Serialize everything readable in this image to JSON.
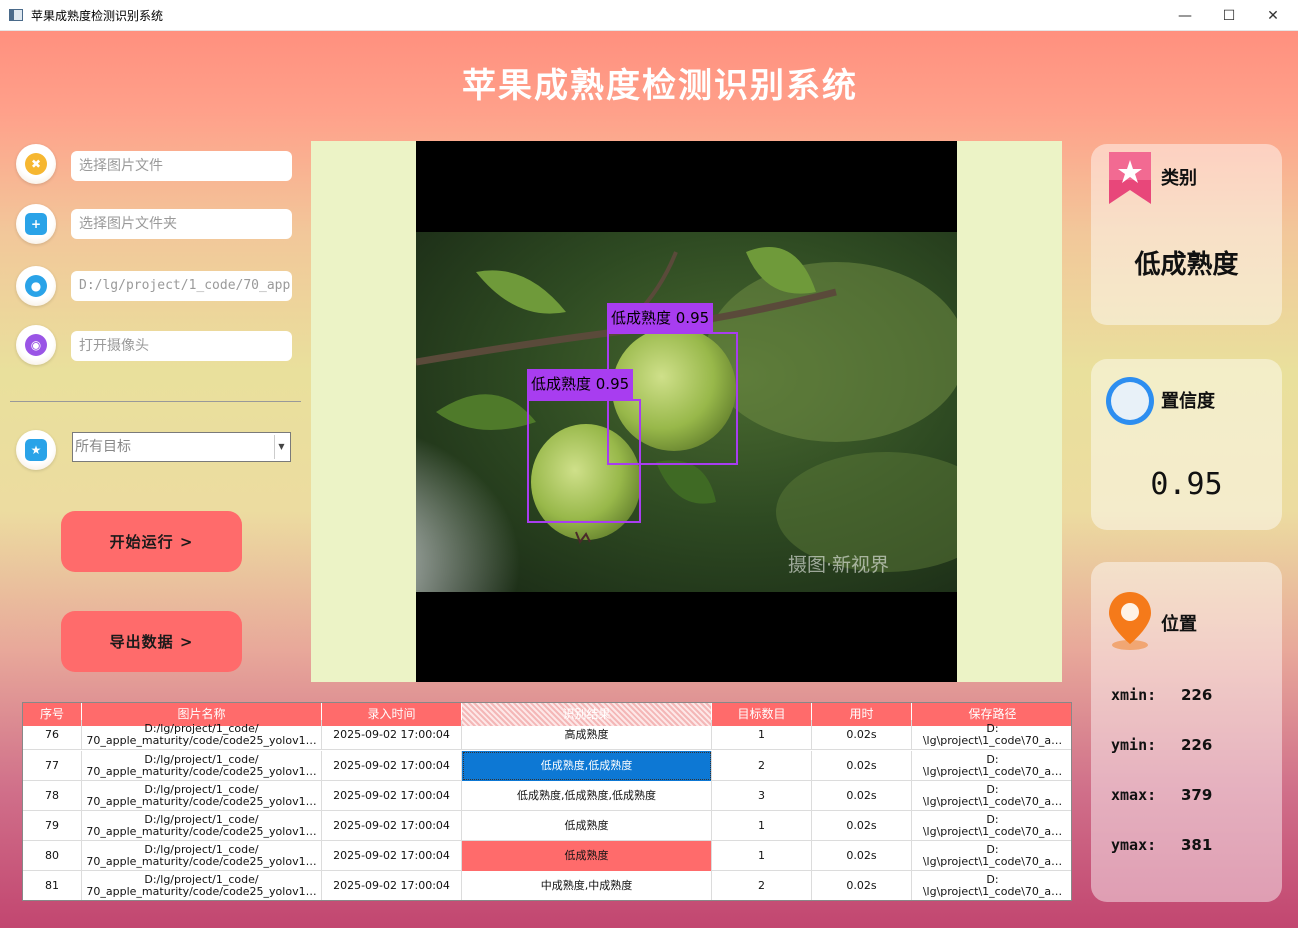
{
  "window": {
    "title": "苹果成熟度检测识别系统"
  },
  "header": {
    "title": "苹果成熟度检测识别系统"
  },
  "left_panel": {
    "image_file_placeholder": "选择图片文件",
    "image_folder_placeholder": "选择图片文件夹",
    "video_path_value": "D:/lg/project/1_code/70_app",
    "camera_placeholder": "打开摄像头",
    "target_select_value": "所有目标",
    "run_button": "开始运行 >",
    "export_button": "导出数据 >"
  },
  "viewer": {
    "watermark": "摄图·新视界",
    "detections": [
      {
        "label": "低成熟度 0.95"
      },
      {
        "label": "低成熟度 0.95"
      }
    ]
  },
  "result_cards": {
    "class_title": "类别",
    "class_value": "低成熟度",
    "confidence_title": "置信度",
    "confidence_value": "0.95",
    "position_title": "位置",
    "xmin_label": "xmin:",
    "xmin_value": "226",
    "ymin_label": "ymin:",
    "ymin_value": "226",
    "xmax_label": "xmax:",
    "xmax_value": "379",
    "ymax_label": "ymax:",
    "ymax_value": "381"
  },
  "table": {
    "headers": [
      "序号",
      "图片名称",
      "录入时间",
      "识别结果",
      "目标数目",
      "用时",
      "保存路径"
    ],
    "rows": [
      {
        "idx": "76",
        "name1": "D:/lg/project/1_code/",
        "name2": "70_apple_maturity/code/code25_yolov1…",
        "time": "2025-09-02 17:00:04",
        "result": "高成熟度",
        "count": "1",
        "duration": "0.02s",
        "path1": "D:",
        "path2": "\\lg\\project\\1_code\\70_a…"
      },
      {
        "idx": "77",
        "name1": "D:/lg/project/1_code/",
        "name2": "70_apple_maturity/code/code25_yolov1…",
        "time": "2025-09-02 17:00:04",
        "result": "低成熟度,低成熟度",
        "count": "2",
        "duration": "0.02s",
        "path1": "D:",
        "path2": "\\lg\\project\\1_code\\70_a…"
      },
      {
        "idx": "78",
        "name1": "D:/lg/project/1_code/",
        "name2": "70_apple_maturity/code/code25_yolov1…",
        "time": "2025-09-02 17:00:04",
        "result": "低成熟度,低成熟度,低成熟度",
        "count": "3",
        "duration": "0.02s",
        "path1": "D:",
        "path2": "\\lg\\project\\1_code\\70_a…"
      },
      {
        "idx": "79",
        "name1": "D:/lg/project/1_code/",
        "name2": "70_apple_maturity/code/code25_yolov1…",
        "time": "2025-09-02 17:00:04",
        "result": "低成熟度",
        "count": "1",
        "duration": "0.02s",
        "path1": "D:",
        "path2": "\\lg\\project\\1_code\\70_a…"
      },
      {
        "idx": "80",
        "name1": "D:/lg/project/1_code/",
        "name2": "70_apple_maturity/code/code25_yolov1…",
        "time": "2025-09-02 17:00:04",
        "result": "低成熟度",
        "count": "1",
        "duration": "0.02s",
        "path1": "D:",
        "path2": "\\lg\\project\\1_code\\70_a…"
      },
      {
        "idx": "81",
        "name1": "D:/lg/project/1_code/",
        "name2": "70_apple_maturity/code/code25_yolov1…",
        "time": "2025-09-02 17:00:04",
        "result": "中成熟度,中成熟度",
        "count": "2",
        "duration": "0.02s",
        "path1": "D:",
        "path2": "\\lg\\project\\1_code\\70_a…"
      }
    ]
  },
  "colors": {
    "accent": "#ff6b6b",
    "detection": "#a83df0",
    "selection": "#0d78d4"
  }
}
